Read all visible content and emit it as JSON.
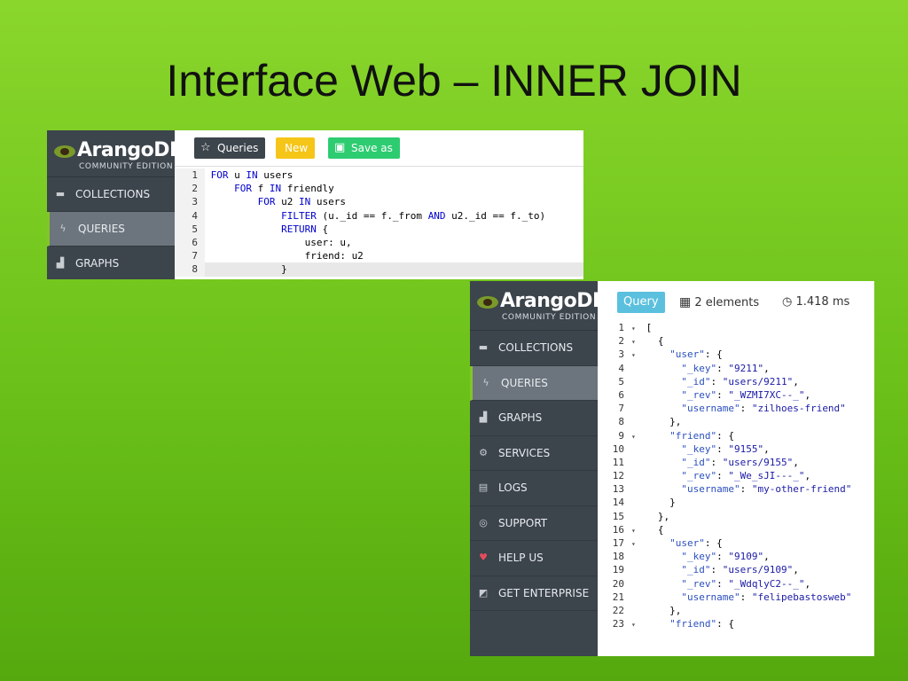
{
  "slide": {
    "title": "Interface Web – INNER JOIN"
  },
  "brand": {
    "name": "ArangoDB",
    "edition": "COMMUNITY EDITION"
  },
  "query_panel": {
    "nav": [
      {
        "label": "COLLECTIONS",
        "icon": "folder-icon"
      },
      {
        "label": "QUERIES",
        "icon": "bolt-icon",
        "active": true
      },
      {
        "label": "GRAPHS",
        "icon": "chart-icon"
      }
    ],
    "toolbar": {
      "queries": "Queries",
      "new": "New",
      "save_as": "Save as"
    },
    "code": [
      {
        "n": "1",
        "t": "FOR u IN users"
      },
      {
        "n": "2",
        "t": "    FOR f IN friendly"
      },
      {
        "n": "3",
        "t": "        FOR u2 IN users"
      },
      {
        "n": "4",
        "t": "            FILTER (u._id == f._from AND u2._id == f._to)"
      },
      {
        "n": "5",
        "t": "            RETURN {"
      },
      {
        "n": "6",
        "t": "                user: u,"
      },
      {
        "n": "7",
        "t": "                friend: u2"
      },
      {
        "n": "8",
        "t": "            }"
      }
    ]
  },
  "result_panel": {
    "nav": [
      {
        "label": "COLLECTIONS",
        "icon": "folder-icon"
      },
      {
        "label": "QUERIES",
        "icon": "bolt-icon",
        "active": true
      },
      {
        "label": "GRAPHS",
        "icon": "chart-icon"
      },
      {
        "label": "SERVICES",
        "icon": "cogs-icon"
      },
      {
        "label": "LOGS",
        "icon": "file-icon"
      },
      {
        "label": "SUPPORT",
        "icon": "lifebuoy-icon"
      },
      {
        "label": "HELP US",
        "icon": "heart-icon"
      },
      {
        "label": "GET ENTERPRISE",
        "icon": "square-icon"
      }
    ],
    "toolbar": {
      "query": "Query",
      "elements": "2 elements",
      "time": "1.418 ms"
    },
    "lines": [
      {
        "n": "1",
        "f": "▾",
        "t": "["
      },
      {
        "n": "2",
        "f": "▾",
        "t": "  {"
      },
      {
        "n": "3",
        "f": "▾",
        "t": "    \"user\": {"
      },
      {
        "n": "4",
        "f": "",
        "t": "      \"_key\": \"9211\","
      },
      {
        "n": "5",
        "f": "",
        "t": "      \"_id\": \"users/9211\","
      },
      {
        "n": "6",
        "f": "",
        "t": "      \"_rev\": \"_WZMI7XC--_\","
      },
      {
        "n": "7",
        "f": "",
        "t": "      \"username\": \"zilhoes-friend\""
      },
      {
        "n": "8",
        "f": "",
        "t": "    },"
      },
      {
        "n": "9",
        "f": "▾",
        "t": "    \"friend\": {"
      },
      {
        "n": "10",
        "f": "",
        "t": "      \"_key\": \"9155\","
      },
      {
        "n": "11",
        "f": "",
        "t": "      \"_id\": \"users/9155\","
      },
      {
        "n": "12",
        "f": "",
        "t": "      \"_rev\": \"_We_sJI---_\","
      },
      {
        "n": "13",
        "f": "",
        "t": "      \"username\": \"my-other-friend\""
      },
      {
        "n": "14",
        "f": "",
        "t": "    }"
      },
      {
        "n": "15",
        "f": "",
        "t": "  },"
      },
      {
        "n": "16",
        "f": "▾",
        "t": "  {"
      },
      {
        "n": "17",
        "f": "▾",
        "t": "    \"user\": {"
      },
      {
        "n": "18",
        "f": "",
        "t": "      \"_key\": \"9109\","
      },
      {
        "n": "19",
        "f": "",
        "t": "      \"_id\": \"users/9109\","
      },
      {
        "n": "20",
        "f": "",
        "t": "      \"_rev\": \"_WdqlyC2--_\","
      },
      {
        "n": "21",
        "f": "",
        "t": "      \"username\": \"felipebastosweb\""
      },
      {
        "n": "22",
        "f": "",
        "t": "    },"
      },
      {
        "n": "23",
        "f": "▾",
        "t": "    \"friend\": {"
      }
    ]
  },
  "colors": {
    "active_accent": "#84c42a",
    "sidebar": "#3c444c",
    "new_btn": "#f5c518",
    "save_btn": "#2ecc71",
    "query_tab": "#5bc0de"
  }
}
